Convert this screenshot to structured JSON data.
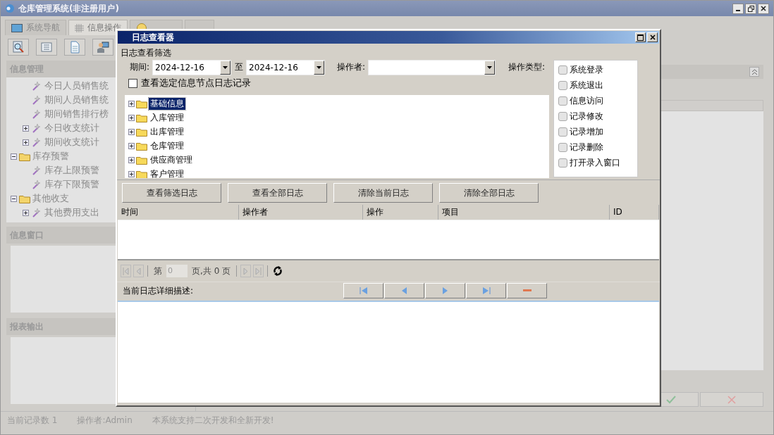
{
  "window": {
    "title": "仓库管理系统(非注册用户)"
  },
  "tabs": [
    {
      "label": "系统导航",
      "selected": false,
      "kind": "monitor"
    },
    {
      "label": "信息操作",
      "selected": true,
      "kind": "grid"
    },
    {
      "selected": false,
      "kind": "help"
    },
    {
      "selected": false,
      "kind": "none"
    }
  ],
  "sidebar": {
    "sections": [
      {
        "title": "信息管理",
        "tree": [
          {
            "children": [
              {
                "label": "今日人员销售统"
              },
              {
                "label": "期间人员销售统"
              },
              {
                "label": "期间销售排行榜"
              },
              {
                "label": "今日收支统计",
                "expanded": false
              },
              {
                "label": "期间收支统计",
                "expanded": false
              }
            ]
          },
          {
            "label": "库存预警",
            "expanded": true,
            "children": [
              {
                "label": "库存上限预警"
              },
              {
                "label": "库存下限预警"
              }
            ]
          },
          {
            "label": "其他收支",
            "expanded": true,
            "children": [
              {
                "label": "其他费用支出",
                "expanded": false
              }
            ]
          }
        ]
      },
      {
        "title": "信息窗口"
      },
      {
        "title": "报表输出"
      }
    ]
  },
  "status_bar": [
    "当前记录数 1",
    "操作者:Admin",
    "本系统支持二次开发和全新开发!"
  ],
  "dialog": {
    "title": "日志查看器",
    "filter_label": "日志查看筛选",
    "period_label": "期间:",
    "date_from": "2024-12-16",
    "to_label": "至",
    "date_to": "2024-12-16",
    "operator_label": "操作者:",
    "operation_type_label": "操作类型:",
    "operation_types": [
      {
        "label": "系统登录",
        "checked": false
      },
      {
        "label": "系统退出",
        "checked": false
      },
      {
        "label": "信息访问",
        "checked": false
      },
      {
        "label": "记录修改",
        "checked": false
      },
      {
        "label": "记录增加",
        "checked": false
      },
      {
        "label": "记录删除",
        "checked": false
      },
      {
        "label": "打开录入窗口",
        "checked": false
      }
    ],
    "node_filter": {
      "label": "查看选定信息节点日志记录",
      "checked": false
    },
    "modules": [
      {
        "label": "基础信息",
        "selected": true
      },
      {
        "label": "入库管理",
        "selected": false
      },
      {
        "label": "出库管理",
        "selected": false
      },
      {
        "label": "仓库管理",
        "selected": false
      },
      {
        "label": "供应商管理",
        "selected": false
      },
      {
        "label": "客户管理",
        "selected": false
      }
    ],
    "buttons": [
      "查看筛选日志",
      "查看全部日志",
      "清除当前日志",
      "清除全部日志"
    ],
    "table": {
      "columns": [
        "时间",
        "操作者",
        "操作",
        "项目",
        "ID"
      ]
    },
    "pager": {
      "page_prefix": "第",
      "page": "0",
      "page_suffix": "页,共 0 页"
    },
    "detail_label": "当前日志详细描述:"
  }
}
